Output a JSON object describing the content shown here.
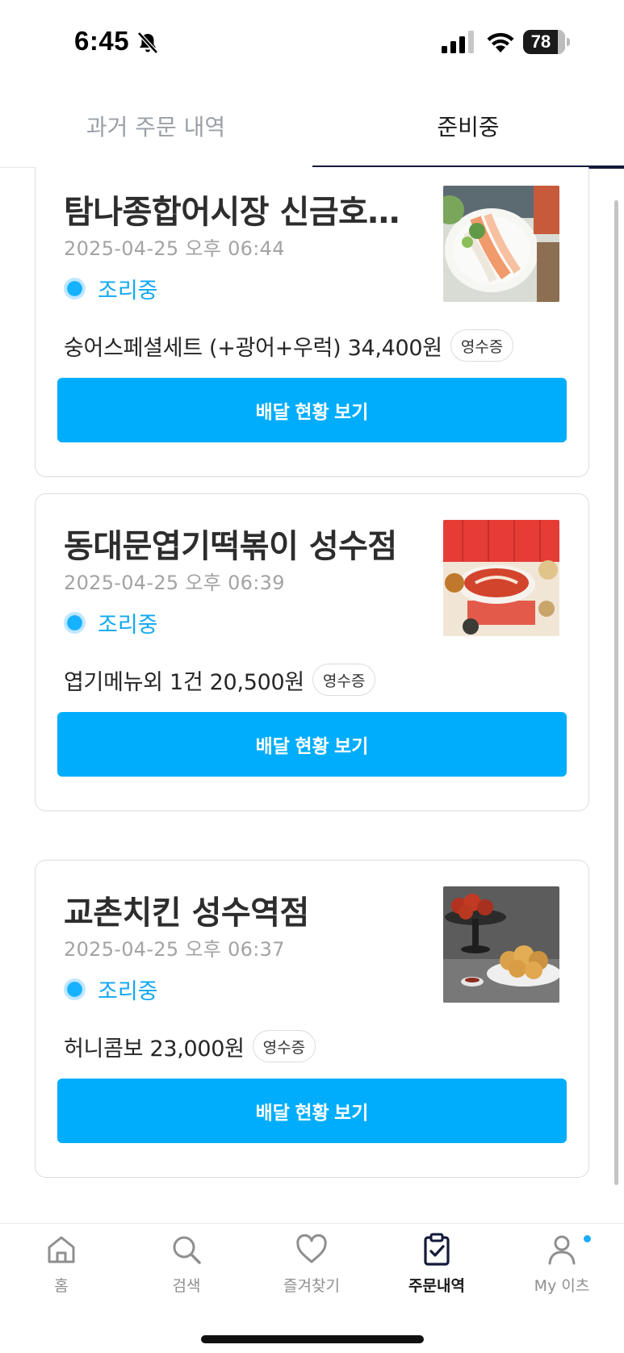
{
  "status_bar": {
    "time": "6:45",
    "battery": "78"
  },
  "tabs": [
    {
      "label": "과거 주문 내역",
      "active": false
    },
    {
      "label": "준비중",
      "active": true
    }
  ],
  "orders": [
    {
      "store": "탐나종합어시장 신금호…",
      "date": "2025-04-25 오후 06:44",
      "status": "조리중",
      "summary": "숭어스페셜세트 (+광어+우럭) 34,400원",
      "receipt": "영수증",
      "action": "배달 현황 보기"
    },
    {
      "store": "동대문엽기떡볶이 성수점",
      "date": "2025-04-25 오후 06:39",
      "status": "조리중",
      "summary": "엽기메뉴외 1건 20,500원",
      "receipt": "영수증",
      "action": "배달 현황 보기"
    },
    {
      "store": "교촌치킨 성수역점",
      "date": "2025-04-25 오후 06:37",
      "status": "조리중",
      "summary": "허니콤보 23,000원",
      "receipt": "영수증",
      "action": "배달 현황 보기"
    }
  ],
  "bottom_nav": [
    {
      "label": "홈",
      "icon": "home-icon"
    },
    {
      "label": "검색",
      "icon": "search-icon"
    },
    {
      "label": "즐겨찾기",
      "icon": "heart-icon"
    },
    {
      "label": "주문내역",
      "icon": "clipboard-check-icon",
      "active": true
    },
    {
      "label": "My 이츠",
      "icon": "person-icon",
      "badge": true
    }
  ],
  "colors": {
    "accent": "#00adfc",
    "status": "#12a8f2",
    "tab_indicator": "#131a3a"
  }
}
